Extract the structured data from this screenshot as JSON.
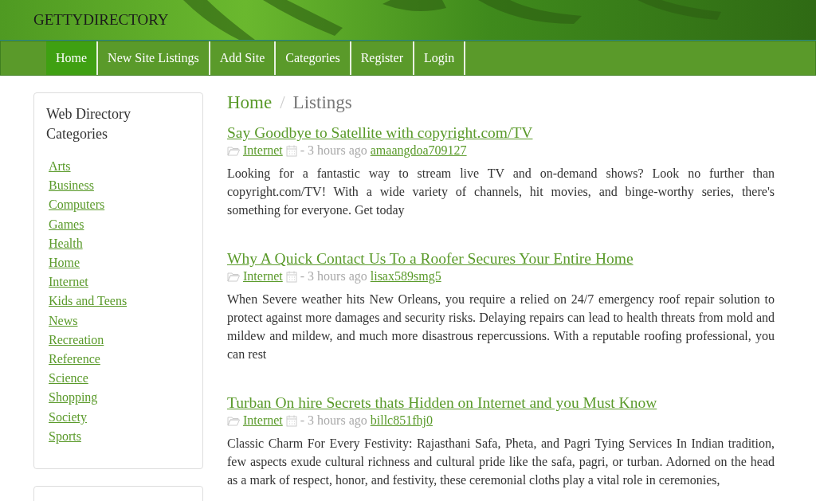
{
  "header": {
    "site_name": "GETTYDIRECTORY"
  },
  "nav": [
    {
      "label": "Home",
      "selected": true
    },
    {
      "label": "New Site Listings",
      "selected": false
    },
    {
      "label": "Add Site",
      "selected": false
    },
    {
      "label": "Categories",
      "selected": false
    },
    {
      "label": "Register",
      "selected": false
    },
    {
      "label": "Login",
      "selected": false
    }
  ],
  "sidebar": {
    "title": "Web Directory Categories",
    "items": [
      "Arts",
      "Business",
      "Computers",
      "Games",
      "Health",
      "Home",
      "Internet",
      "Kids and Teens",
      "News",
      "Recreation",
      "Reference",
      "Science",
      "Shopping",
      "Society",
      "Sports"
    ]
  },
  "breadcrumb": [
    "Home",
    "Listings"
  ],
  "breadcrumb_separator": "/",
  "listings": [
    {
      "title": "Say Goodbye to Satellite with copyright.com/TV",
      "category": "Internet",
      "time": "- 3 hours ago",
      "user": "amaangdoa709127",
      "description": "Looking for a fantastic way to stream live TV and on-demand shows? Look no further than copyright.com/TV! With a wide variety of channels, hit movies, and binge-worthy series, there's something for everyone. Get today"
    },
    {
      "title": "Why A Quick Contact Us To a Roofer Secures Your Entire Home",
      "category": "Internet",
      "time": "- 3 hours ago",
      "user": "lisax589smg5",
      "description": "When Severe weather hits New Orleans, you require a relied on 24/7 emergency roof repair solution to protect against more damages and security risks. Delaying repairs can lead to health threats from mold and mildew and mildew, and much more disastrous repercussions. With a reputable roofing professional, you can rest"
    },
    {
      "title": "Turban On hire Secrets thats Hidden on Internet and you Must Know",
      "category": "Internet",
      "time": "- 3 hours ago",
      "user": "billc851fhj0",
      "description": "Classic Charm For Every Festivity: Rajasthani Safa, Pheta, and Pagri Tying Services In Indian tradition, few aspects exude cultural richness and cultural pride like the safa, pagri, or turban. Adorned on the head as a mark of respect, honor, and festivity, these ceremonial cloths play a vital role in ceremonies,"
    }
  ]
}
